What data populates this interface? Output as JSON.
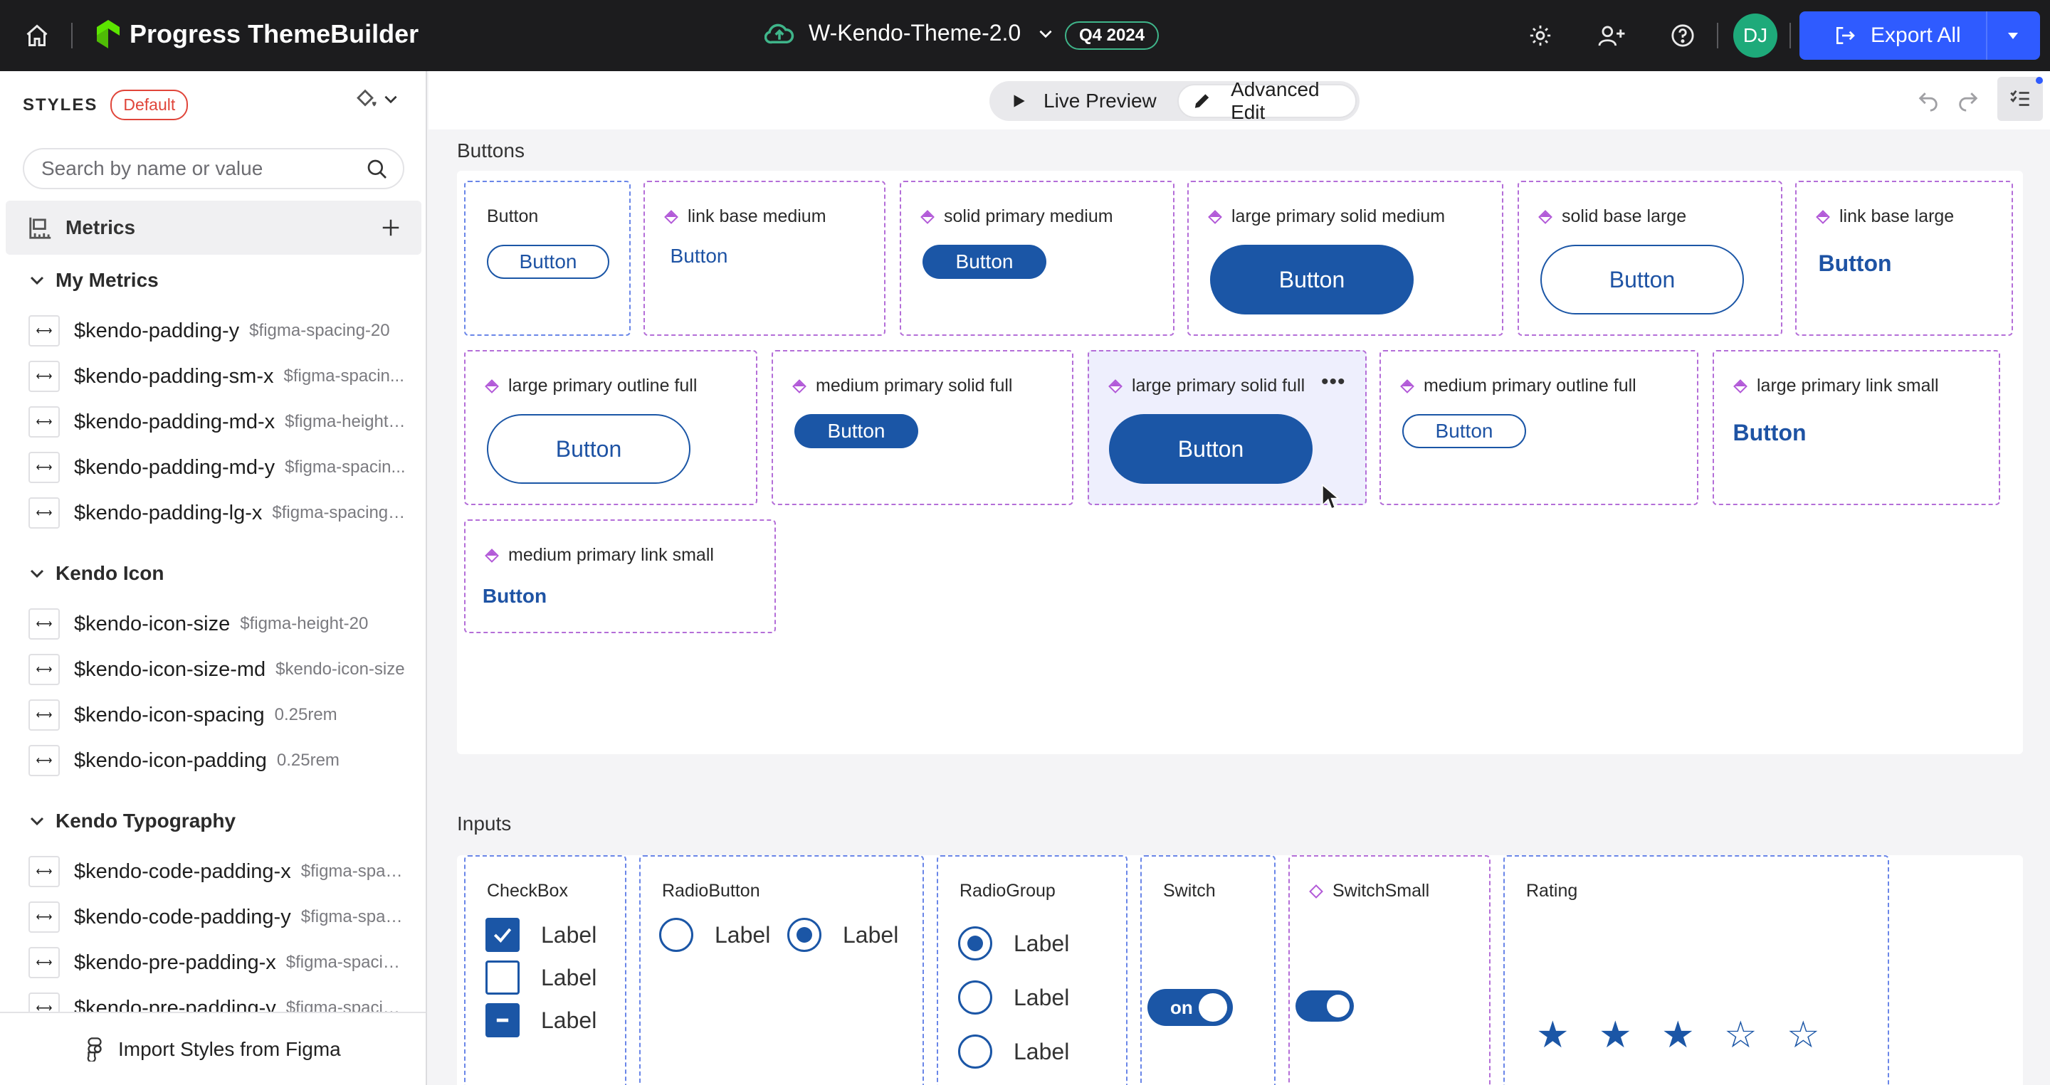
{
  "topbar": {
    "brand": "Progress ThemeBuilder",
    "project_title": "W-Kendo-Theme-2.0",
    "release_badge": "Q4 2024",
    "avatar_initials": "DJ",
    "export_label": "Export All",
    "icons": [
      "home-icon",
      "cloud-upload-icon",
      "chevron-down-icon",
      "gear-icon",
      "add-user-icon",
      "help-icon",
      "export-icon",
      "caret-down-icon"
    ]
  },
  "sidebar": {
    "styles_label": "STYLES",
    "default_badge": "Default",
    "search_placeholder": "Search by name or value",
    "metrics_label": "Metrics",
    "groups": [
      {
        "title": "My Metrics",
        "items": [
          {
            "name": "$kendo-padding-y",
            "value": "$figma-spacing-20"
          },
          {
            "name": "$kendo-padding-sm-x",
            "value": "$figma-spacin..."
          },
          {
            "name": "$kendo-padding-md-x",
            "value": "$figma-height-..."
          },
          {
            "name": "$kendo-padding-md-y",
            "value": "$figma-spacin..."
          },
          {
            "name": "$kendo-padding-lg-x",
            "value": "$figma-spacing-..."
          }
        ]
      },
      {
        "title": "Kendo Icon",
        "items": [
          {
            "name": "$kendo-icon-size",
            "value": "$figma-height-20"
          },
          {
            "name": "$kendo-icon-size-md",
            "value": "$kendo-icon-size"
          },
          {
            "name": "$kendo-icon-spacing",
            "value": "0.25rem"
          },
          {
            "name": "$kendo-icon-padding",
            "value": "0.25rem"
          }
        ]
      },
      {
        "title": "Kendo Typography",
        "items": [
          {
            "name": "$kendo-code-padding-x",
            "value": "$figma-spac..."
          },
          {
            "name": "$kendo-code-padding-y",
            "value": "$figma-spac..."
          },
          {
            "name": "$kendo-pre-padding-x",
            "value": "$figma-spacin..."
          },
          {
            "name": "$kendo-pre-padding-y",
            "value": "$figma-spacin..."
          }
        ]
      }
    ],
    "import_label": "Import Styles from Figma"
  },
  "toolbar": {
    "live_preview": "Live Preview",
    "advanced_edit": "Advanced Edit"
  },
  "buttons_section": {
    "title": "Buttons",
    "button_text": "Button",
    "cards": [
      {
        "title": "Button"
      },
      {
        "title": "link base medium"
      },
      {
        "title": "solid primary medium"
      },
      {
        "title": "large primary solid medium"
      },
      {
        "title": "solid base large"
      },
      {
        "title": "link base large"
      },
      {
        "title": "large primary outline full"
      },
      {
        "title": "medium primary solid full"
      },
      {
        "title": "large primary solid full"
      },
      {
        "title": "medium primary outline full"
      },
      {
        "title": "large primary link small"
      },
      {
        "title": "medium primary link small"
      }
    ]
  },
  "inputs_section": {
    "title": "Inputs",
    "checkbox": {
      "title": "CheckBox",
      "labels": [
        "Label",
        "Label",
        "Label"
      ],
      "states": [
        "checked",
        "unchecked",
        "indeterminate"
      ]
    },
    "radiobutton": {
      "title": "RadioButton",
      "labels": [
        "Label",
        "Label"
      ],
      "selected": 1
    },
    "radiogroup": {
      "title": "RadioGroup",
      "labels": [
        "Label",
        "Label",
        "Label"
      ],
      "selected": 0
    },
    "switch": {
      "title": "Switch",
      "state_label": "on",
      "on": true
    },
    "switch_small": {
      "title": "SwitchSmall",
      "on": true
    },
    "rating": {
      "title": "Rating",
      "value": 3,
      "max": 5
    }
  },
  "colors": {
    "primary": "#1b56a6",
    "export": "#2f5bff",
    "accent_green": "#3fb58a",
    "default_badge": "#e0453a"
  }
}
